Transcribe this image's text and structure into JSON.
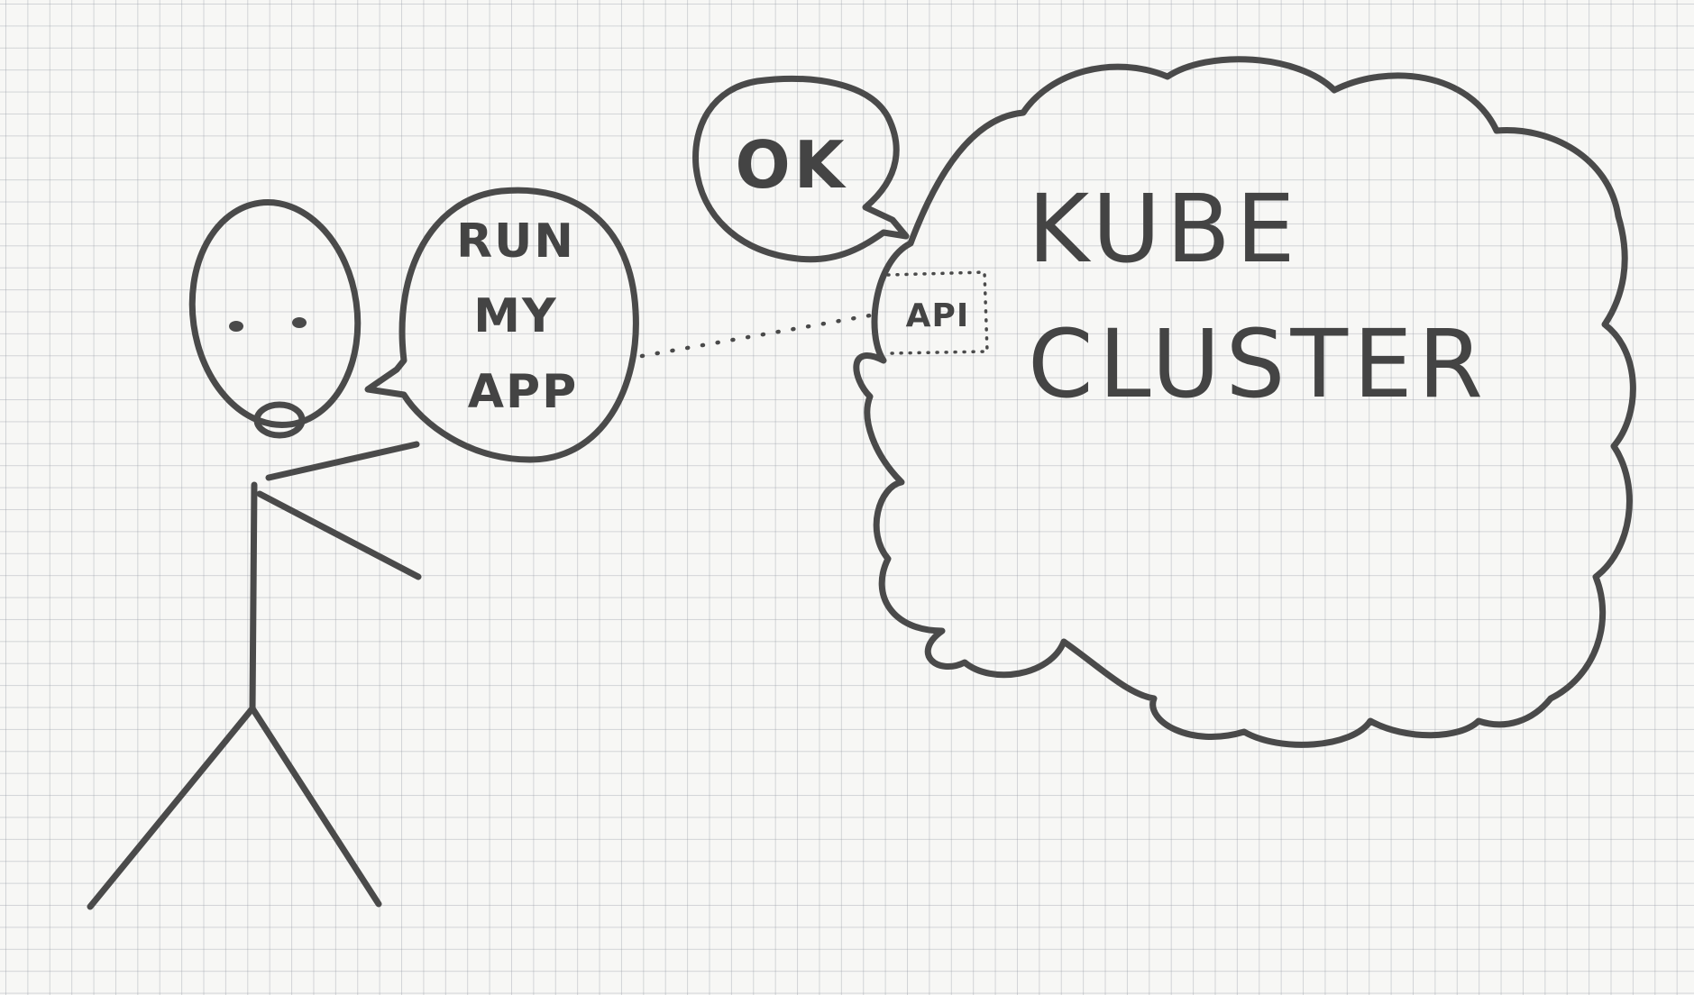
{
  "speech_bubble_person": [
    "RUN",
    "MY",
    "APP"
  ],
  "speech_bubble_cluster": "OK",
  "api_label": "API",
  "cluster_label": [
    "KUBE",
    "CLUSTER"
  ],
  "colors": {
    "ink": "#4a4a4a",
    "paper": "#f7f7f5",
    "grid": "#969ba5"
  }
}
